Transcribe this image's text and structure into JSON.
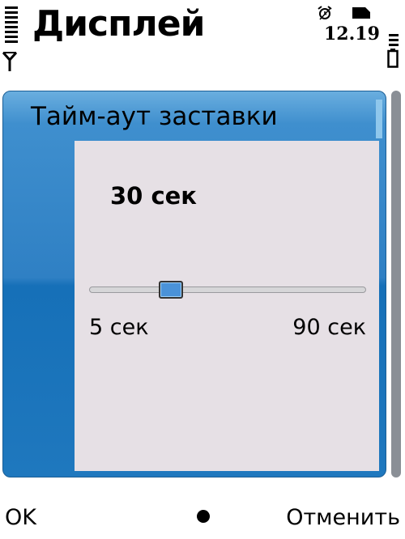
{
  "status_bar": {
    "app_title": "Дисплей",
    "time": "12.19",
    "alarm_icon": "alarm-clock-icon",
    "sim_icon": "sim-card-icon",
    "signal_icon": "signal-strength-icon",
    "battery_icon": "battery-level-icon"
  },
  "dialog": {
    "title": "Тайм-аут заставки",
    "current_value": "30 сек",
    "min_label": "5 сек",
    "max_label": "90 сек",
    "slider_fraction": 0.294,
    "accent_color": "#2f80c4",
    "body_color": "#e6e0e5"
  },
  "softkeys": {
    "left": "OK",
    "middle_icon": "selection-dot-icon",
    "right": "Отменить"
  }
}
